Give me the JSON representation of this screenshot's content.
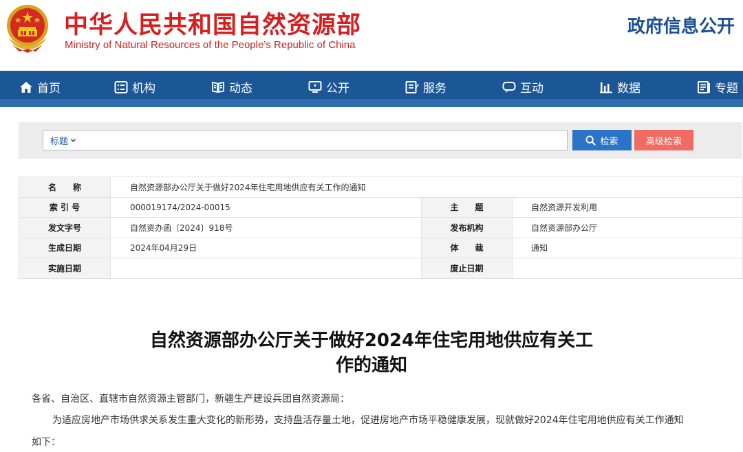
{
  "header": {
    "title": "中华人民共和国自然资源部",
    "subtitle": "Ministry of Natural Resources of the People’s Republic of China",
    "right_label": "政府信息公开"
  },
  "nav": {
    "items": [
      {
        "label": "首页",
        "icon": "home-icon"
      },
      {
        "label": "机构",
        "icon": "org-icon"
      },
      {
        "label": "动态",
        "icon": "news-icon"
      },
      {
        "label": "公开",
        "icon": "disclosure-icon"
      },
      {
        "label": "服务",
        "icon": "service-icon"
      },
      {
        "label": "互动",
        "icon": "chat-icon"
      },
      {
        "label": "数据",
        "icon": "bar-chart-icon"
      },
      {
        "label": "专题",
        "icon": "topic-icon"
      }
    ]
  },
  "search": {
    "scope_label": "标题",
    "placeholder": "",
    "button_label": "检索",
    "advanced_label": "高级检索"
  },
  "info": {
    "name_label": "名　　称",
    "name_value": "自然资源部办公厅关于做好2024年住宅用地供应有关工作的通知",
    "index_label": "索 引 号",
    "index_value": "000019174/2024-00015",
    "topic_label": "主　　题",
    "topic_value": "自然资源开发利用",
    "docno_label": "发文字号",
    "docno_value": "自然资办函〔2024〕918号",
    "issuer_label": "发布机构",
    "issuer_value": "自然资源部办公厅",
    "date_label": "生成日期",
    "date_value": "2024年04月29日",
    "genre_label": "体　　裁",
    "genre_value": "通知",
    "effective_label": "实施日期",
    "effective_value": "",
    "expiry_label": "废止日期",
    "expiry_value": ""
  },
  "article": {
    "title_line1": "自然资源部办公厅关于做好2024年住宅用地供应有关工",
    "title_line2": "作的通知",
    "salutation": "各省、自治区、直辖市自然资源主管部门，新疆生产建设兵团自然资源局：",
    "para1_line1": "为适应房地产市场供求关系发生重大变化的新形势，支持盘活存量土地，促进房地产市场平稳健康发展，现就做好2024年住宅用地供应有关工作通知",
    "para1_line2": "如下："
  },
  "colors": {
    "brand_red": "#d81e1e",
    "nav_blue": "#1b5696",
    "search_blue": "#2a73c9",
    "advanced_red": "#f06b61"
  }
}
